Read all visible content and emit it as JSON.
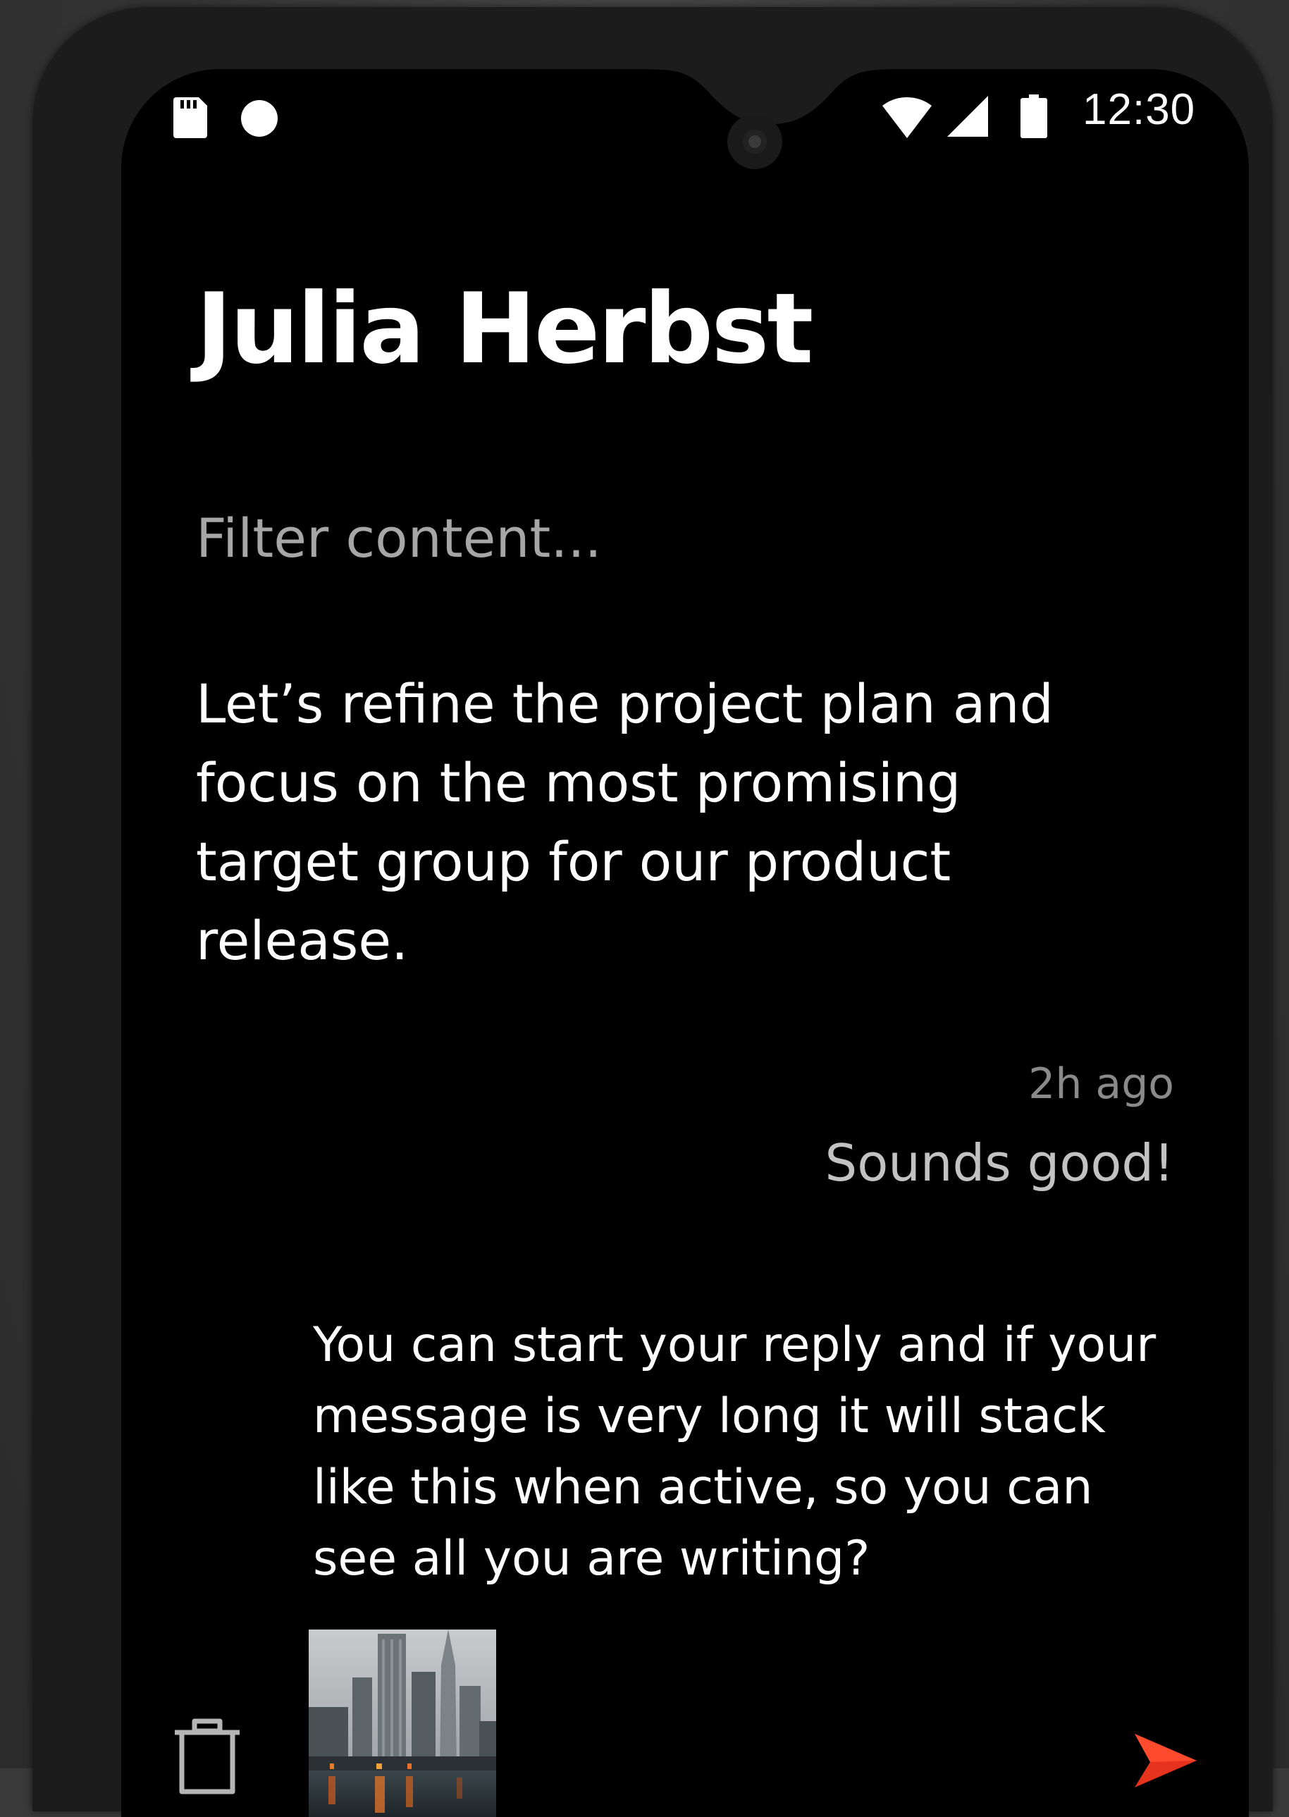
{
  "status_bar": {
    "time": "12:30",
    "icons": [
      "sd-card-icon",
      "notification-dot-icon",
      "wifi-icon",
      "cell-signal-icon",
      "battery-icon"
    ]
  },
  "conversation": {
    "contact_name": "Julia Herbst",
    "filter_placeholder": "Filter content...",
    "message_text": "Let’s refine the project plan and focus on the most promising target group for our product release.",
    "reply_timestamp": "2h ago",
    "reply_text": "Sounds good!"
  },
  "composer": {
    "draft_text": "You can start your reply and if your message is very long it will stack like this when active, so you can see all you are writing?",
    "icons": {
      "delete": "trash-icon",
      "attachment": "city-photo",
      "send": "send-icon"
    }
  },
  "colors": {
    "background": "#000000",
    "frame": "#1c1c1c",
    "primary_text": "#ffffff",
    "secondary_text": "#a6a6a6",
    "accent": "#e5331e"
  }
}
